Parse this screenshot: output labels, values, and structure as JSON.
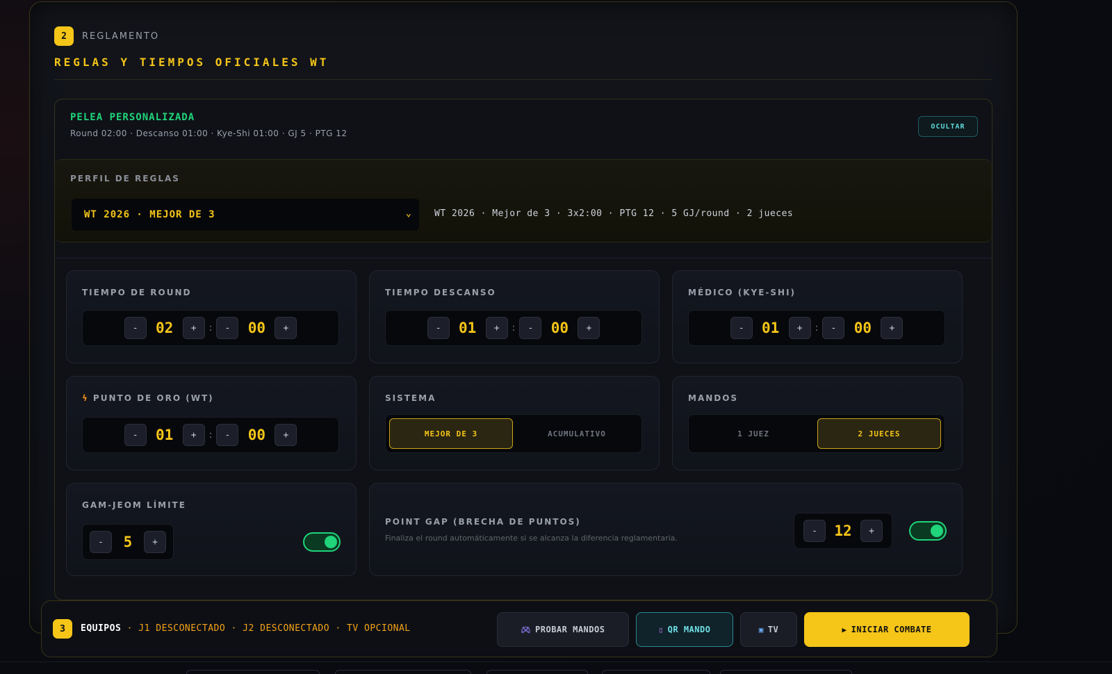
{
  "section": {
    "number": "2",
    "label": "REGLAMENTO",
    "title": "REGLAS Y TIEMPOS OFICIALES WT"
  },
  "custom_fight": {
    "title": "PELEA PERSONALIZADA",
    "summary": "Round 02:00 · Descanso 01:00 · Kye-Shi 01:00 · GJ 5 · PTG 12",
    "hide_label": "OCULTAR"
  },
  "profile": {
    "label": "PERFIL DE REGLAS",
    "selected": "WT 2026 · MEJOR DE 3",
    "description": "WT 2026 · Mejor de 3 · 3x2:00 · PTG 12 · 5 GJ/round · 2 jueces"
  },
  "round_time": {
    "label": "TIEMPO DE ROUND",
    "minutes": "02",
    "seconds": "00"
  },
  "rest_time": {
    "label": "TIEMPO DESCANSO",
    "minutes": "01",
    "seconds": "00"
  },
  "medical": {
    "label": "MÉDICO (KYE-SHI)",
    "minutes": "01",
    "seconds": "00"
  },
  "golden_point": {
    "label": "PUNTO DE ORO (WT)",
    "minutes": "01",
    "seconds": "00"
  },
  "system": {
    "label": "SISTEMA",
    "options": [
      "MEJOR DE 3",
      "ACUMULATIVO"
    ],
    "selected": "MEJOR DE 3"
  },
  "controllers": {
    "label": "MANDOS",
    "options": [
      "1 JUEZ",
      "2 JUECES"
    ],
    "selected": "2 JUECES"
  },
  "gamjeom": {
    "label": "GAM-JEOM LÍMITE",
    "value": "5",
    "enabled": true
  },
  "point_gap": {
    "label": "POINT GAP (BRECHA DE PUNTOS)",
    "description": "Finaliza el round automáticamente si se alcanza la diferencia reglamentaria.",
    "value": "12",
    "enabled": true
  },
  "stepper": {
    "minus": "-",
    "plus": "+"
  },
  "footer": {
    "number": "3",
    "title": "EQUIPOS",
    "status": "· J1 DESCONECTADO · J2 DESCONECTADO · TV OPCIONAL",
    "buttons": {
      "test": "PROBAR MANDOS",
      "qr": "QR MANDO",
      "tv": "TV",
      "start": "INICIAR COMBATE"
    }
  },
  "icons": [
    "gamepad-icon",
    "phone-icon",
    "tv-icon",
    "play-icon",
    "bolt-icon",
    "chevron-down-icon"
  ],
  "colors": {
    "accent": "#f5c518",
    "success": "#1fd47a",
    "cyan": "#5fd6d8"
  }
}
